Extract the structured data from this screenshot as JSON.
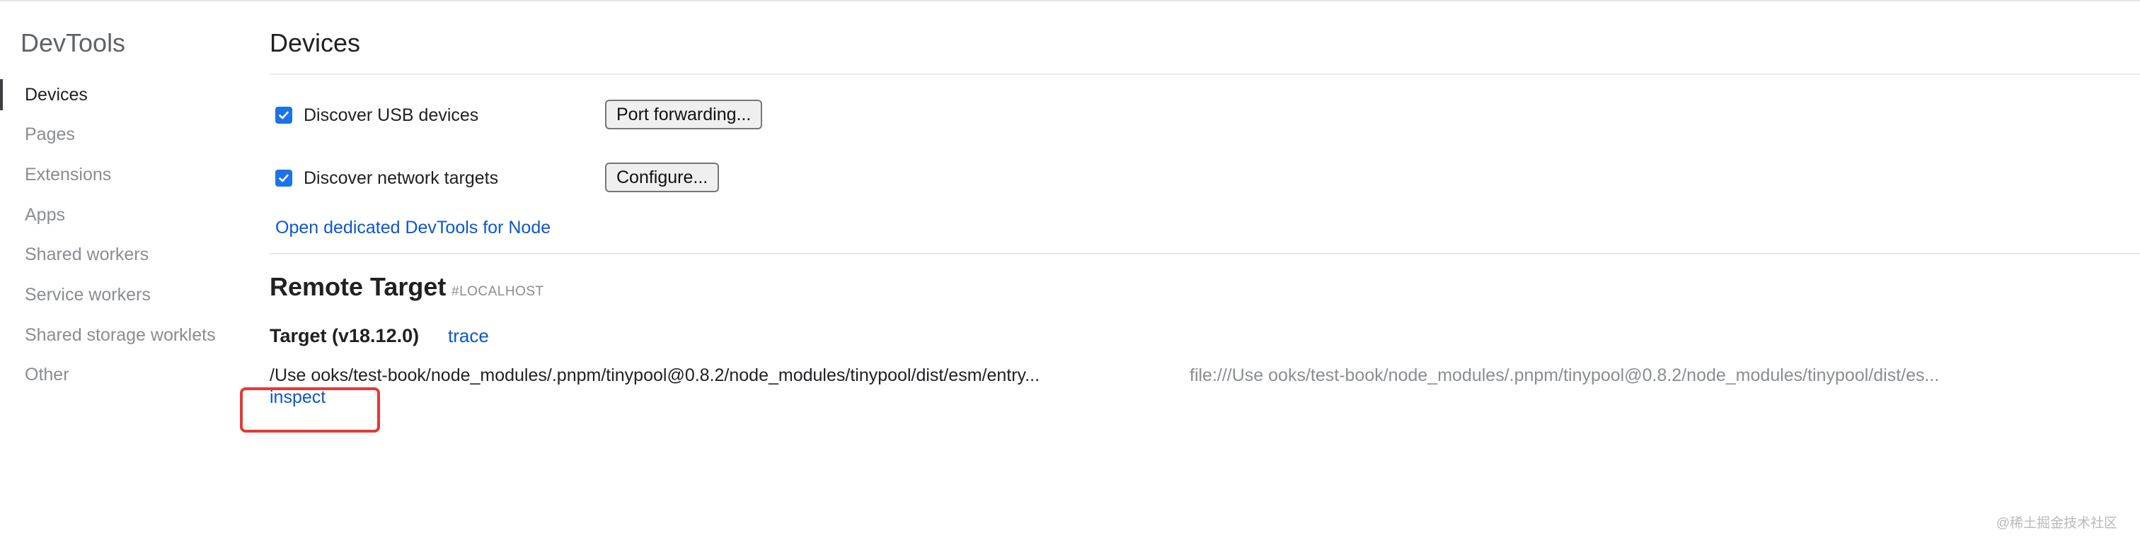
{
  "sidebar": {
    "title": "DevTools",
    "items": [
      {
        "label": "Devices",
        "active": true
      },
      {
        "label": "Pages"
      },
      {
        "label": "Extensions"
      },
      {
        "label": "Apps"
      },
      {
        "label": "Shared workers"
      },
      {
        "label": "Service workers"
      },
      {
        "label": "Shared storage worklets"
      },
      {
        "label": "Other"
      }
    ]
  },
  "main": {
    "title": "Devices",
    "discover_usb": {
      "label": "Discover USB devices",
      "checked": true,
      "button": "Port forwarding..."
    },
    "discover_network": {
      "label": "Discover network targets",
      "checked": true,
      "button": "Configure..."
    },
    "node_link": "Open dedicated DevTools for Node"
  },
  "remote": {
    "title": "Remote Target",
    "tag": "#LOCALHOST",
    "target": {
      "name": "Target (v18.12.0)",
      "trace_link": "trace",
      "path": "/Use        ooks/test-book/node_modules/.pnpm/tinypool@0.8.2/node_modules/tinypool/dist/esm/entry...",
      "url": "file:///Use                ooks/test-book/node_modules/.pnpm/tinypool@0.8.2/node_modules/tinypool/dist/es...",
      "inspect_link": "inspect"
    }
  },
  "watermark": "@稀土掘金技术社区",
  "colors": {
    "accent": "#1a73e8",
    "link": "#0b57d0",
    "highlight": "#e53935"
  }
}
